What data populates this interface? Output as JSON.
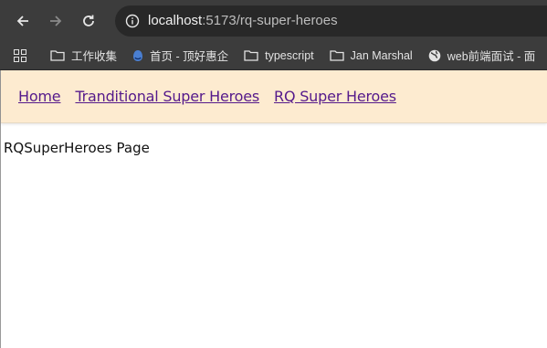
{
  "browser": {
    "url_host": "localhost",
    "url_path": ":5173/rq-super-heroes"
  },
  "bookmarks": [
    {
      "label": "工作收集",
      "icon": "folder-icon"
    },
    {
      "label": "首页 - 顶好惠企",
      "icon": "site-favicon-icon"
    },
    {
      "label": "typescript",
      "icon": "folder-icon"
    },
    {
      "label": "Jan Marshal",
      "icon": "folder-icon"
    },
    {
      "label": "web前端面试 - 面",
      "icon": "globe-icon"
    }
  ],
  "nav": {
    "home": "Home",
    "traditional": "Tranditional Super Heroes",
    "rq": "RQ Super Heroes"
  },
  "main": {
    "heading": "RQSuperHeroes Page"
  },
  "colors": {
    "toolbar_bg": "#3c3c3c",
    "nav_bg": "#fdebd0",
    "link": "#551a8b"
  }
}
